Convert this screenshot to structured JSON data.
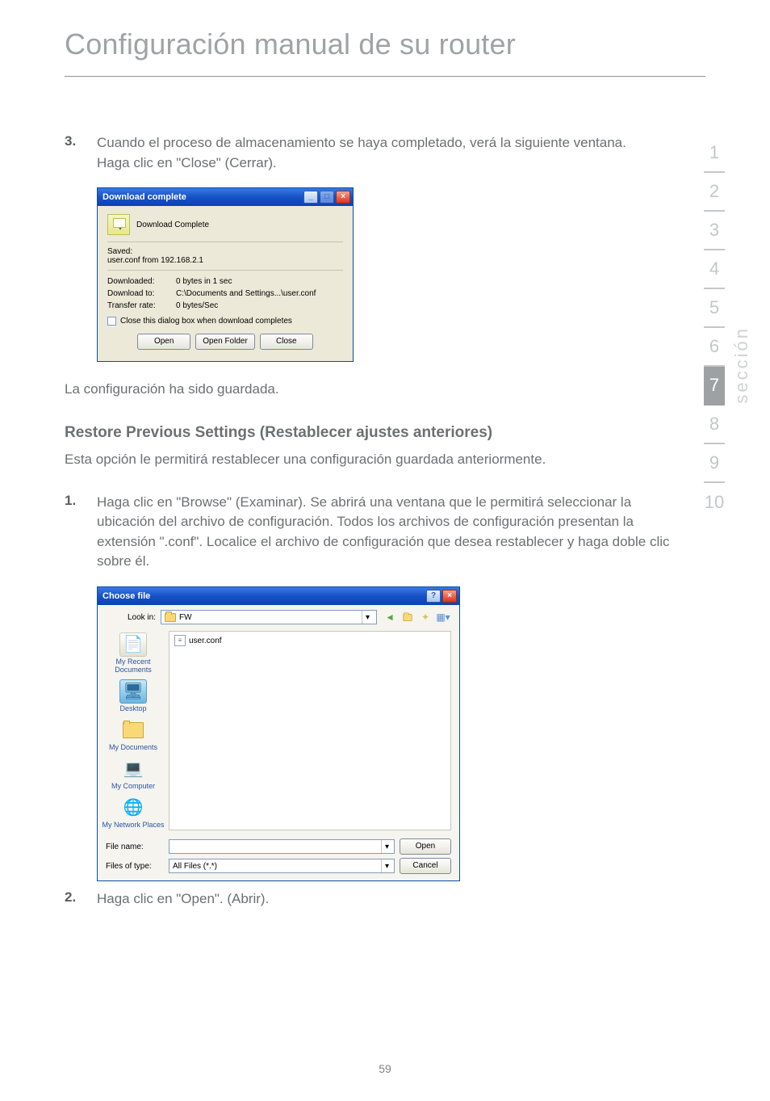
{
  "page": {
    "title": "Configuración manual de su router",
    "number": "59"
  },
  "nav": {
    "items": [
      "1",
      "2",
      "3",
      "4",
      "5",
      "6",
      "7",
      "8",
      "9",
      "10"
    ],
    "active_index": 6,
    "seccion_label": "sección"
  },
  "step3": {
    "num": "3.",
    "line1": "Cuando el proceso de almacenamiento se haya completado, verá la siguiente ventana.",
    "line2": "Haga clic en \"Close\" (Cerrar)."
  },
  "download_dialog": {
    "title": "Download complete",
    "heading": "Download Complete",
    "saved_label": "Saved:",
    "saved_path": "user.conf from 192.168.2.1",
    "kv": [
      {
        "k": "Downloaded:",
        "v": "0 bytes in 1 sec"
      },
      {
        "k": "Download to:",
        "v": "C:\\Documents and Settings...\\user.conf"
      },
      {
        "k": "Transfer rate:",
        "v": "0 bytes/Sec"
      }
    ],
    "checkbox_label": "Close this dialog box when download completes",
    "buttons": {
      "open": "Open",
      "open_folder": "Open Folder",
      "close": "Close"
    },
    "winbtns": {
      "min": "_",
      "max": "□",
      "close": "×"
    }
  },
  "after_download_text": "La configuración ha sido guardada.",
  "restore_heading": "Restore Previous Settings (Restablecer ajustes anteriores)",
  "restore_intro": "Esta opción le permitirá restablecer una configuración guardada anteriormente.",
  "step1": {
    "num": "1.",
    "text": "Haga clic en \"Browse\" (Examinar). Se abrirá una ventana que le permitirá seleccionar la ubicación del archivo de configuración. Todos los archivos de configuración presentan la extensión \".conf\". Localice el archivo de configuración que desea restablecer y haga doble clic sobre él."
  },
  "choose_dialog": {
    "title": "Choose file",
    "help_icon": "?",
    "close_icon": "×",
    "lookin_label": "Look in:",
    "lookin_value": "FW",
    "file_item": "user.conf",
    "places": [
      {
        "label": "My Recent Documents"
      },
      {
        "label": "Desktop"
      },
      {
        "label": "My Documents"
      },
      {
        "label": "My Computer"
      },
      {
        "label": "My Network Places"
      }
    ],
    "filename_label": "File name:",
    "filename_value": "",
    "filetype_label": "Files of type:",
    "filetype_value": "All Files (*.*)",
    "open_btn": "Open",
    "cancel_btn": "Cancel"
  },
  "step2": {
    "num": "2.",
    "text": "Haga clic en \"Open\". (Abrir)."
  }
}
